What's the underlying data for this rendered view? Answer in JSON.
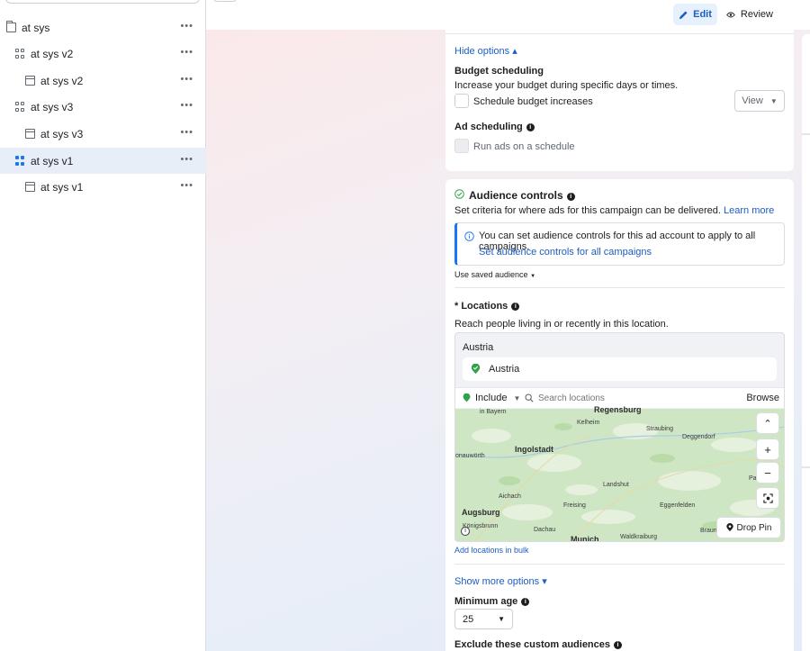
{
  "sidebar": {
    "items": [
      {
        "label": "at sys",
        "icon": "folder-icon",
        "more": "•••"
      },
      {
        "label": "at sys v2",
        "icon": "adset-grid-icon",
        "more": "•••"
      },
      {
        "label": "at sys v2",
        "icon": "ad-icon",
        "more": "•••"
      },
      {
        "label": "at sys v3",
        "icon": "adset-grid-icon",
        "more": "•••"
      },
      {
        "label": "at sys v3",
        "icon": "ad-icon",
        "more": "•••"
      },
      {
        "label": "at sys v1",
        "icon": "adset-grid-icon",
        "more": "•••",
        "selected": true
      },
      {
        "label": "at sys v1",
        "icon": "ad-icon",
        "more": "•••"
      }
    ]
  },
  "header": {
    "edit_label": "Edit",
    "review_label": "Review"
  },
  "budget": {
    "hide_options": "Hide options ▴",
    "scheduling_title": "Budget scheduling",
    "scheduling_desc": "Increase your budget during specific days or times.",
    "schedule_checkbox": "Schedule budget increases",
    "view_label": "View",
    "ad_scheduling_title": "Ad scheduling",
    "run_ads_checkbox": "Run ads on a schedule"
  },
  "audience": {
    "title": "Audience controls",
    "desc": "Set criteria for where ads for this campaign can be delivered.",
    "learn_more": "Learn more",
    "notice_text": "You can set audience controls for this ad account to apply to all campaigns.",
    "notice_link": "Set audience controls for all campaigns",
    "saved_audience": "Use saved audience",
    "locations_title": "* Locations",
    "locations_desc": "Reach people living in or recently in this location.",
    "location_group": "Austria",
    "location_chip": "Austria",
    "include_label": "Include",
    "search_placeholder": "Search locations",
    "browse_label": "Browse",
    "drop_pin": "Drop Pin",
    "add_bulk": "Add locations in bulk",
    "show_more": "Show more options ▾",
    "min_age_title": "Minimum age",
    "min_age_value": "25",
    "exclude_title": "Exclude these custom audiences"
  },
  "map": {
    "cities": {
      "regensburg": "Regensburg",
      "bayern": "in Bayern",
      "kelheim": "Kelheim",
      "straubing": "Straubing",
      "deggendorf": "Deggendorf",
      "ingolstadt": "Ingolstadt",
      "donauworth": "onauwörth",
      "landshut": "Landshut",
      "aichach": "Aichach",
      "freising": "Freising",
      "eggenfelden": "Eggenfelden",
      "augsburg": "Augsburg",
      "konigsbrunn": "Königsbrunn",
      "dachau": "Dachau",
      "munich": "Munich",
      "waldkraiburg": "Waldkraiburg",
      "braunau": "Braun",
      "passau": "Pas"
    },
    "controls": {
      "collapse": "⌃",
      "zoom_in": "+",
      "zoom_out": "−"
    }
  }
}
